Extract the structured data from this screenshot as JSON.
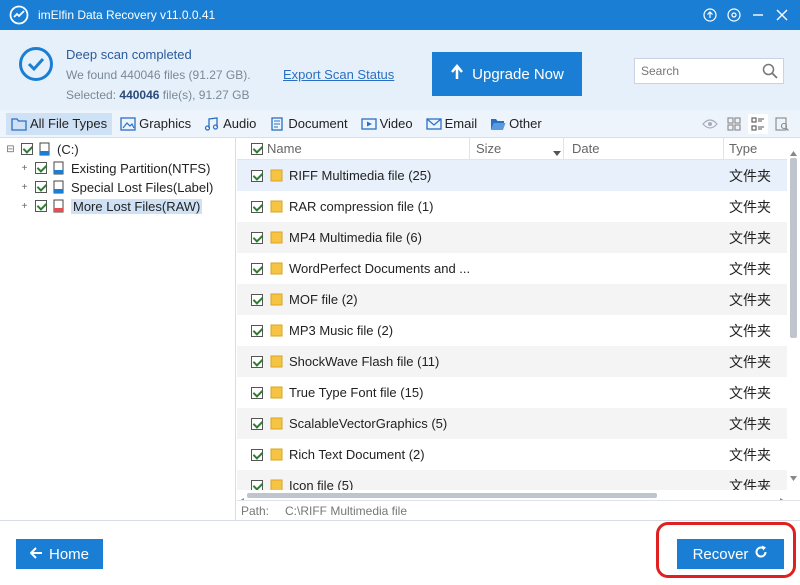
{
  "window": {
    "title": "imElfin Data Recovery v11.0.0.41",
    "controls": [
      "upload-icon",
      "settings-icon",
      "minimize-icon",
      "close-icon"
    ]
  },
  "header": {
    "scan_title": "Deep scan completed",
    "found_text": "We found 440046 files (91.27 GB).",
    "selected_prefix": "Selected:",
    "selected_count": "440046",
    "selected_suffix": "file(s), 91.27 GB",
    "export_link": "Export Scan Status",
    "upgrade_label": "Upgrade Now",
    "search_placeholder": "Search"
  },
  "filters": {
    "tabs": [
      {
        "label": "All File Types",
        "icon": "folder-icon",
        "active": true
      },
      {
        "label": "Graphics",
        "icon": "image-icon"
      },
      {
        "label": "Audio",
        "icon": "music-icon"
      },
      {
        "label": "Document",
        "icon": "document-icon"
      },
      {
        "label": "Video",
        "icon": "video-icon"
      },
      {
        "label": "Email",
        "icon": "email-icon"
      },
      {
        "label": "Other",
        "icon": "folder-open-icon"
      }
    ],
    "view_icons": [
      "eye-icon",
      "grid-view-icon",
      "list-view-icon",
      "preview-icon"
    ]
  },
  "tree": {
    "root": "(C:)",
    "items": [
      "Existing Partition(NTFS)",
      "Special Lost Files(Label)",
      "More Lost Files(RAW)"
    ],
    "selected": "More Lost Files(RAW)"
  },
  "list": {
    "columns": {
      "name": "Name",
      "size": "Size",
      "date": "Date",
      "type": "Type"
    },
    "rows": [
      {
        "name": "RIFF Multimedia file (25)",
        "type": "文件夹"
      },
      {
        "name": "RAR compression file (1)",
        "type": "文件夹"
      },
      {
        "name": "MP4 Multimedia file (6)",
        "type": "文件夹"
      },
      {
        "name": "WordPerfect Documents and ...",
        "type": "文件夹"
      },
      {
        "name": "MOF file (2)",
        "type": "文件夹"
      },
      {
        "name": "MP3 Music file (2)",
        "type": "文件夹"
      },
      {
        "name": "ShockWave Flash file (11)",
        "type": "文件夹"
      },
      {
        "name": "True Type Font file (15)",
        "type": "文件夹"
      },
      {
        "name": "ScalableVectorGraphics (5)",
        "type": "文件夹"
      },
      {
        "name": "Rich Text Document (2)",
        "type": "文件夹"
      },
      {
        "name": "Icon file (5)",
        "type": "文件夹"
      }
    ]
  },
  "pathbar": {
    "label": "Path:",
    "value": "C:\\RIFF Multimedia file"
  },
  "footer": {
    "home_label": "Home",
    "recover_label": "Recover"
  },
  "colors": {
    "accent": "#1a7fd4",
    "header_bg": "#e6f0fa",
    "highlight": "#e02020"
  }
}
